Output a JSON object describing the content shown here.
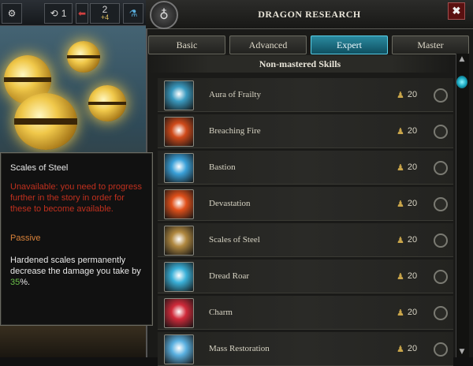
{
  "topbar": {
    "count_a": "1",
    "count_b": "2",
    "count_b_delta": "+4"
  },
  "window": {
    "title": "DRAGON RESEARCH",
    "close_label": "✖"
  },
  "tabs": [
    {
      "label": "Basic",
      "active": false
    },
    {
      "label": "Advanced",
      "active": false
    },
    {
      "label": "Expert",
      "active": true
    },
    {
      "label": "Master",
      "active": false
    }
  ],
  "section_title": "Non-mastered Skills",
  "skills": [
    {
      "name": "Aura of Frailty",
      "cost": "20",
      "icon": "aura-of-frailty-icon",
      "color": "#3a9ac0"
    },
    {
      "name": "Breaching Fire",
      "cost": "20",
      "icon": "breaching-fire-icon",
      "color": "#d04a1a"
    },
    {
      "name": "Bastion",
      "cost": "20",
      "icon": "bastion-icon",
      "color": "#3aa0d8"
    },
    {
      "name": "Devastation",
      "cost": "20",
      "icon": "devastation-icon",
      "color": "#e0501a"
    },
    {
      "name": "Scales of Steel",
      "cost": "20",
      "icon": "scales-of-steel-icon",
      "color": "#b08840"
    },
    {
      "name": "Dread Roar",
      "cost": "20",
      "icon": "dread-roar-icon",
      "color": "#3ab0d8"
    },
    {
      "name": "Charm",
      "cost": "20",
      "icon": "charm-icon",
      "color": "#d02a3a"
    },
    {
      "name": "Mass Restoration",
      "cost": "20",
      "icon": "mass-restoration-icon",
      "color": "#5ab0e0"
    }
  ],
  "tooltip": {
    "title": "Scales of Steel",
    "warning": "Unavailable: you need to progress further in the story in order for these to become available.",
    "type": "Passive",
    "desc_before": "Hardened scales permanently decrease the damage you take by ",
    "desc_value": "35",
    "desc_after": "%."
  },
  "colors": {
    "accent": "#2a8aa0",
    "warning": "#c0301e",
    "passive": "#d8823a",
    "highlight": "#6ac04a"
  }
}
